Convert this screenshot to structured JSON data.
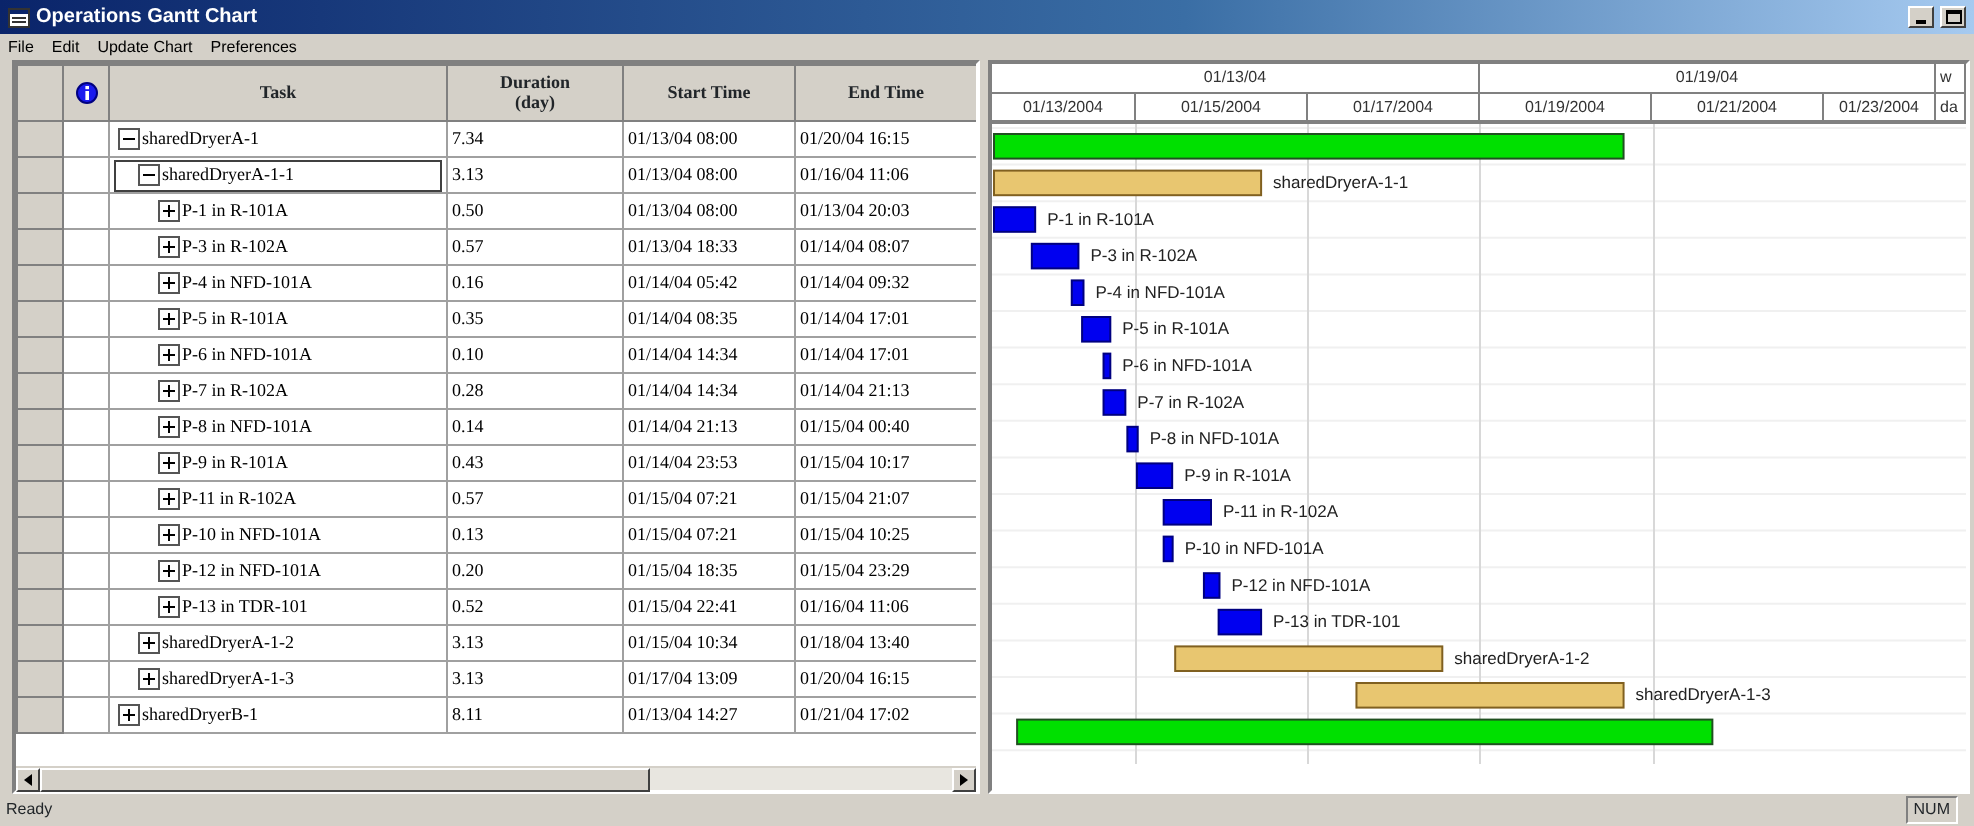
{
  "window": {
    "title": "Operations Gantt Chart"
  },
  "menu": [
    "File",
    "Edit",
    "Update Chart",
    "Preferences"
  ],
  "table": {
    "columns": [
      "Task",
      "Duration\n(day)",
      "Start Time",
      "End Time"
    ],
    "rows": [
      {
        "task": "sharedDryerA-1",
        "duration": "7.34",
        "start": "01/13/04 08:00",
        "end": "01/20/04 16:15",
        "kind": "batch",
        "expanded": true,
        "selected": false,
        "children": [
          {
            "task": "sharedDryerA-1-1",
            "duration": "3.13",
            "start": "01/13/04 08:00",
            "end": "01/16/04 11:06",
            "kind": "group",
            "bar_label": "sharedDryerA-1-1",
            "expanded": true,
            "selected": true,
            "children": [
              {
                "task": "P-1 in R-101A",
                "duration": "0.50",
                "start": "01/13/04 08:00",
                "end": "01/13/04 20:03",
                "kind": "operation",
                "bar_label": "P-1 in R-101A",
                "expanded": false,
                "selected": false
              },
              {
                "task": "P-3 in R-102A",
                "duration": "0.57",
                "start": "01/13/04 18:33",
                "end": "01/14/04 08:07",
                "kind": "operation",
                "bar_label": "P-3 in R-102A",
                "expanded": false,
                "selected": false
              },
              {
                "task": "P-4 in NFD-101A",
                "duration": "0.16",
                "start": "01/14/04 05:42",
                "end": "01/14/04 09:32",
                "kind": "operation",
                "bar_label": "P-4 in NFD-101A",
                "expanded": false,
                "selected": false
              },
              {
                "task": "P-5 in R-101A",
                "duration": "0.35",
                "start": "01/14/04 08:35",
                "end": "01/14/04 17:01",
                "kind": "operation",
                "bar_label": "P-5 in R-101A",
                "expanded": false,
                "selected": false
              },
              {
                "task": "P-6 in NFD-101A",
                "duration": "0.10",
                "start": "01/14/04 14:34",
                "end": "01/14/04 17:01",
                "kind": "operation",
                "bar_label": "P-6 in NFD-101A",
                "expanded": false,
                "selected": false
              },
              {
                "task": "P-7 in R-102A",
                "duration": "0.28",
                "start": "01/14/04 14:34",
                "end": "01/14/04 21:13",
                "kind": "operation",
                "bar_label": "P-7 in R-102A",
                "expanded": false,
                "selected": false
              },
              {
                "task": "P-8 in NFD-101A",
                "duration": "0.14",
                "start": "01/14/04 21:13",
                "end": "01/15/04 00:40",
                "kind": "operation",
                "bar_label": "P-8 in NFD-101A",
                "expanded": false,
                "selected": false
              },
              {
                "task": "P-9 in R-101A",
                "duration": "0.43",
                "start": "01/14/04 23:53",
                "end": "01/15/04 10:17",
                "kind": "operation",
                "bar_label": "P-9 in R-101A",
                "expanded": false,
                "selected": false
              },
              {
                "task": "P-11 in R-102A",
                "duration": "0.57",
                "start": "01/15/04 07:21",
                "end": "01/15/04 21:07",
                "kind": "operation",
                "bar_label": "P-11 in R-102A",
                "expanded": false,
                "selected": false
              },
              {
                "task": "P-10 in NFD-101A",
                "duration": "0.13",
                "start": "01/15/04 07:21",
                "end": "01/15/04 10:25",
                "kind": "operation",
                "bar_label": "P-10 in NFD-101A",
                "expanded": false,
                "selected": false
              },
              {
                "task": "P-12 in NFD-101A",
                "duration": "0.20",
                "start": "01/15/04 18:35",
                "end": "01/15/04 23:29",
                "kind": "operation",
                "bar_label": "P-12 in NFD-101A",
                "expanded": false,
                "selected": false
              },
              {
                "task": "P-13 in TDR-101",
                "duration": "0.52",
                "start": "01/15/04 22:41",
                "end": "01/16/04 11:06",
                "kind": "operation",
                "bar_label": "P-13 in TDR-101",
                "expanded": false,
                "selected": false
              }
            ]
          },
          {
            "task": "sharedDryerA-1-2",
            "duration": "3.13",
            "start": "01/15/04 10:34",
            "end": "01/18/04 13:40",
            "kind": "group",
            "bar_label": "sharedDryerA-1-2",
            "expanded": false,
            "selected": false
          },
          {
            "task": "sharedDryerA-1-3",
            "duration": "3.13",
            "start": "01/17/04 13:09",
            "end": "01/20/04 16:15",
            "kind": "group",
            "bar_label": "sharedDryerA-1-3",
            "expanded": false,
            "selected": false
          }
        ]
      },
      {
        "task": "sharedDryerB-1",
        "duration": "8.11",
        "start": "01/13/04 14:27",
        "end": "01/21/04 17:02",
        "kind": "batch",
        "expanded": false,
        "selected": false
      }
    ]
  },
  "timeline": {
    "major": [
      "01/13/04",
      "01/19/04",
      "w"
    ],
    "minor": [
      "01/13/2004",
      "01/15/2004",
      "01/17/2004",
      "01/19/2004",
      "01/21/2004",
      "01/23/2004",
      "da"
    ]
  },
  "status_bar": {
    "message": "Ready",
    "indicator": "NUM"
  }
}
